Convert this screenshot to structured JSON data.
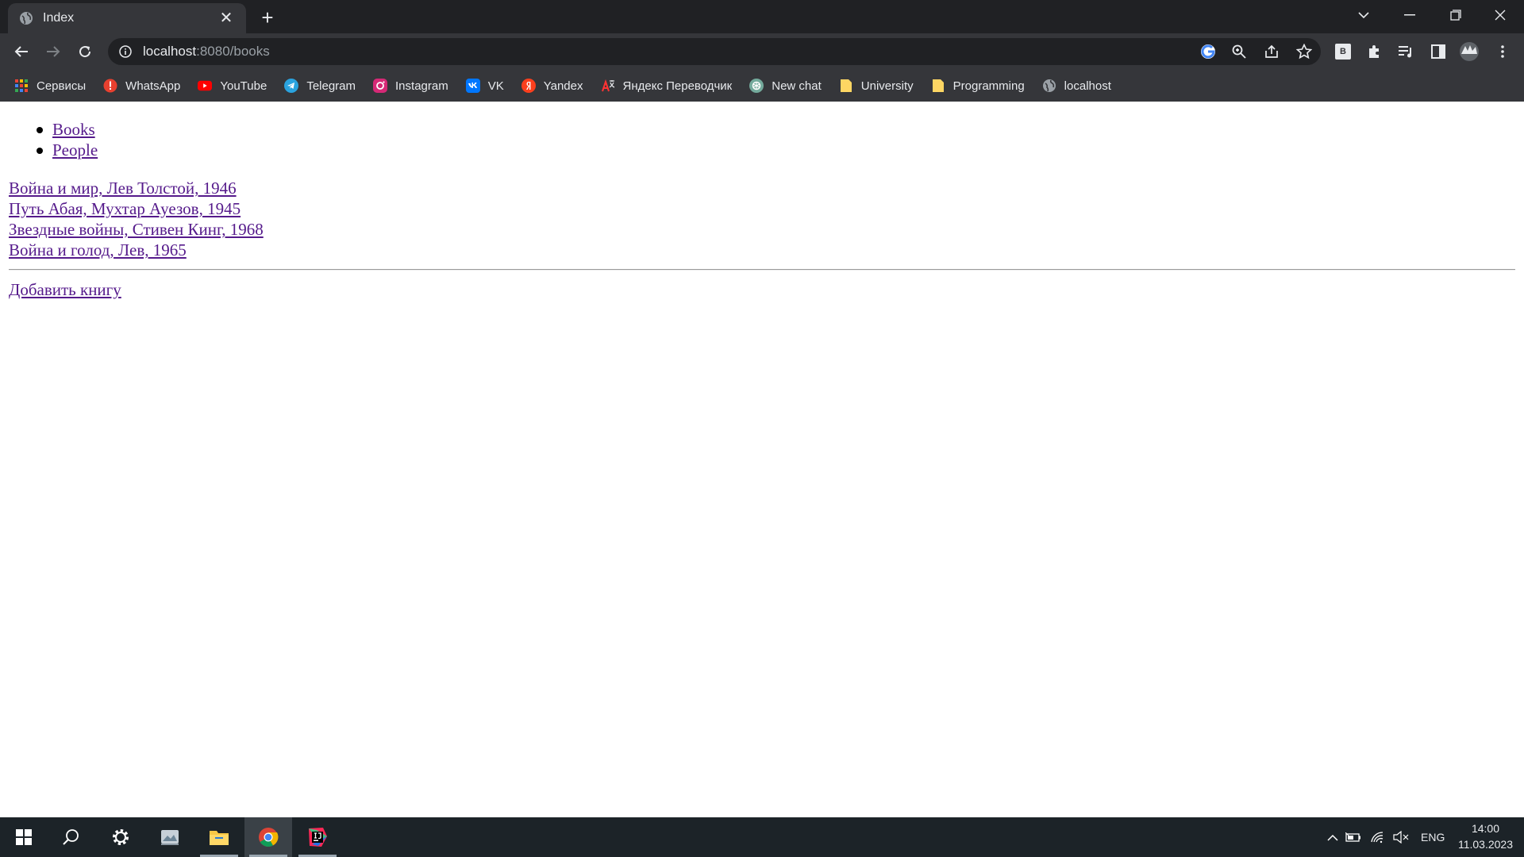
{
  "browser": {
    "tab_title": "Index",
    "url_host": "localhost",
    "url_rest": ":8080/books",
    "bookmarks": [
      {
        "label": "Сервисы",
        "icon": "apps-grid-icon"
      },
      {
        "label": "WhatsApp",
        "icon": "whatsapp-icon"
      },
      {
        "label": "YouTube",
        "icon": "youtube-icon"
      },
      {
        "label": "Telegram",
        "icon": "telegram-icon"
      },
      {
        "label": "Instagram",
        "icon": "instagram-icon"
      },
      {
        "label": "VK",
        "icon": "vk-icon"
      },
      {
        "label": "Yandex",
        "icon": "yandex-icon"
      },
      {
        "label": "Яндекс Переводчик",
        "icon": "translate-icon"
      },
      {
        "label": "New chat",
        "icon": "chatgpt-icon"
      },
      {
        "label": "University",
        "icon": "folder-icon"
      },
      {
        "label": "Programming",
        "icon": "folder-icon"
      },
      {
        "label": "localhost",
        "icon": "globe-icon"
      }
    ],
    "extension_badge": "B"
  },
  "page": {
    "nav": [
      {
        "label": "Books"
      },
      {
        "label": "People"
      }
    ],
    "books": [
      "Война и мир, Лев Толстой, 1946",
      "Путь Абая, Мухтар Ауезов, 1945",
      "Звездные войны, Стивен Кинг, 1968",
      "Война и голод, Лев, 1965"
    ],
    "add_book_label": "Добавить книгу"
  },
  "taskbar": {
    "language": "ENG",
    "time": "14:00",
    "date": "11.03.2023"
  },
  "colors": {
    "link_visited": "#551a8b",
    "chrome_dark": "#202124",
    "chrome_toolbar": "#35363a",
    "taskbar": "#1c2328"
  }
}
